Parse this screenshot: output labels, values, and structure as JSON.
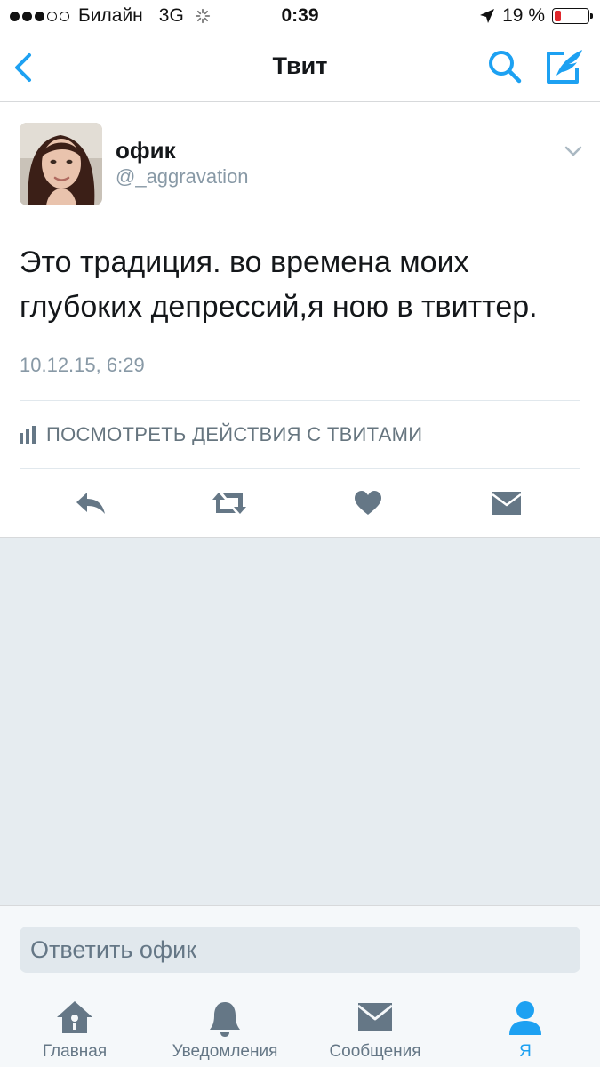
{
  "status_bar": {
    "carrier": "Билайн",
    "network": "3G",
    "time": "0:39",
    "battery_percent_text": "19 %",
    "battery_level": 0.19,
    "signal_bars_filled": 3,
    "signal_bars_total": 5
  },
  "nav": {
    "title": "Твит",
    "back_icon": "chevron-left-icon",
    "search_icon": "search-icon",
    "compose_icon": "compose-tweet-icon"
  },
  "tweet": {
    "display_name": "офик",
    "username": "@_aggravation",
    "text": "Это традиция. во времена моих глубоких депрессий,я ною в твиттер.",
    "timestamp": "10.12.15, 6:29",
    "analytics_label": "ПОСМОТРЕТЬ ДЕЙСТВИЯ С ТВИТАМИ",
    "actions": [
      "reply-icon",
      "retweet-icon",
      "like-icon",
      "direct-message-icon"
    ]
  },
  "reply": {
    "placeholder": "Ответить офик"
  },
  "tabs": [
    {
      "label": "Главная",
      "icon": "home-icon",
      "active": false
    },
    {
      "label": "Уведомления",
      "icon": "bell-icon",
      "active": false
    },
    {
      "label": "Сообщения",
      "icon": "envelope-icon",
      "active": false
    },
    {
      "label": "Я",
      "icon": "user-icon",
      "active": true
    }
  ],
  "colors": {
    "accent": "#1da1f2",
    "icon_gray": "#657786",
    "background_gray": "#e6ecf0",
    "battery_low": "#e0282d"
  }
}
